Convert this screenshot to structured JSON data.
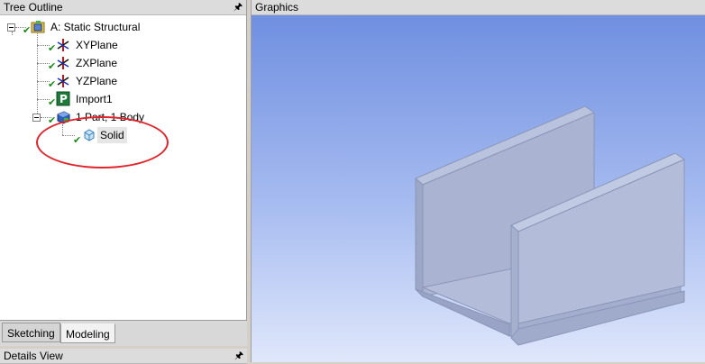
{
  "tree_outline": {
    "title": "Tree Outline",
    "pin_icon": "pin-icon",
    "nodes": [
      {
        "label": "A: Static Structural",
        "icon": "static-structural-icon"
      },
      {
        "label": "XYPlane",
        "icon": "plane-axes-icon"
      },
      {
        "label": "ZXPlane",
        "icon": "plane-axes-icon"
      },
      {
        "label": "YZPlane",
        "icon": "plane-axes-icon"
      },
      {
        "label": "Import1",
        "icon": "import-icon"
      },
      {
        "label": "1 Part, 1 Body",
        "icon": "parts-bodies-icon"
      },
      {
        "label": "Solid",
        "icon": "solid-body-icon"
      }
    ],
    "status_check_color": "#1a8a1a"
  },
  "tabs": [
    {
      "label": "Sketching",
      "active": false
    },
    {
      "label": "Modeling",
      "active": true
    }
  ],
  "details_view": {
    "title": "Details View"
  },
  "graphics": {
    "title": "Graphics",
    "background_top": "#6f8fe0",
    "background_bottom": "#dfe7fb",
    "model_description_icon": "u-channel-solid"
  },
  "annotation": {
    "color": "#e0242b"
  }
}
